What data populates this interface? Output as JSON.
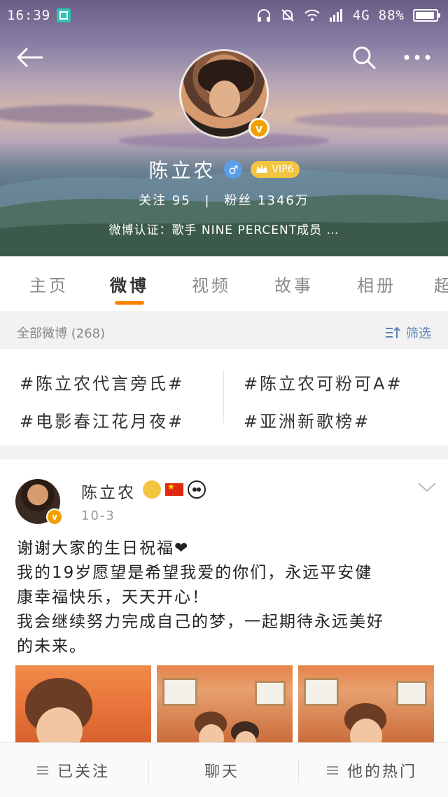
{
  "status_bar": {
    "time": "16:39",
    "network": "4G",
    "battery": "88%"
  },
  "profile": {
    "name": "陈立农",
    "vip_label": "VIP6",
    "follow_text": "关注 95",
    "separator": "|",
    "fans_text": "粉丝 1346万",
    "verify_text": "微博认证：歌手 NINE PERCENT成员 …",
    "verified_mark": "v",
    "gender_mark": "♂"
  },
  "tabs": [
    "主页",
    "微博",
    "视频",
    "故事",
    "相册",
    "超"
  ],
  "active_tab_index": 1,
  "filter_bar": {
    "all_weibo": "全部微博 (268)",
    "filter_label": "筛选"
  },
  "topics": [
    "#陈立农代言旁氏#",
    "#陈立农可粉可A#",
    "#电影春江花月夜#",
    "#亚洲新歌榜#"
  ],
  "post": {
    "author": "陈立农",
    "time": "10-3",
    "verified_mark": "v",
    "text_lines": [
      "谢谢大家的生日祝福❤",
      "我的19岁愿望是希望我爱的你们，永远平安健",
      "康幸福快乐，天天开心！",
      "我会继续努力完成自己的梦，一起期待永远美好",
      "的未来。"
    ]
  },
  "bottom_bar": {
    "followed": "已关注",
    "chat": "聊天",
    "his_hot": "他的热门"
  },
  "colors": {
    "accent": "#ff8200",
    "link_blue": "#5b83b3",
    "vip_gold": "#f2c43f",
    "verified_orange": "#f0a100"
  }
}
